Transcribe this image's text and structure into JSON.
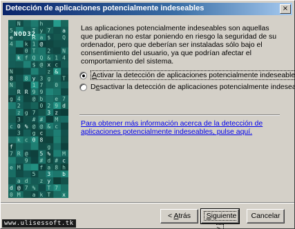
{
  "window": {
    "title": "Detección de aplicaciones potencialmente indeseables",
    "close_glyph": "×"
  },
  "banner": {
    "label": "NOD32"
  },
  "description": "Las aplicaciones potencialmente indeseables son aquellas que pudieran no estar poniendo en riesgo la seguridad de su ordenador, pero que deberían ser instaladas sólo bajo el consentimiento del usuario, ya que podrían afectar el comportamiento del sistema.",
  "options": [
    {
      "accel": "A",
      "label_rest": "ctivar la detección de aplicaciones potencialmente indeseables",
      "checked": true
    },
    {
      "prefix": "D",
      "accel": "e",
      "label_rest": "sactivar la detección de aplicaciones potencialmente indeseables",
      "checked": false
    }
  ],
  "info_link": "Para obtener más información acerca de la detección de aplicaciones potencialmente indeseables, pulse aquí.",
  "buttons": {
    "back_arrow": "< ",
    "back_accel": "A",
    "back_rest": "trás",
    "next_accel": "S",
    "next_rest": "iguiente >",
    "cancel": "Cancelar"
  },
  "watermark": "www.ulisessoft.tk",
  "colors": {
    "titlebar_start": "#0a246a",
    "link": "#0000ee",
    "face": "#d4d0c8",
    "banner": "#0c3c3c"
  }
}
